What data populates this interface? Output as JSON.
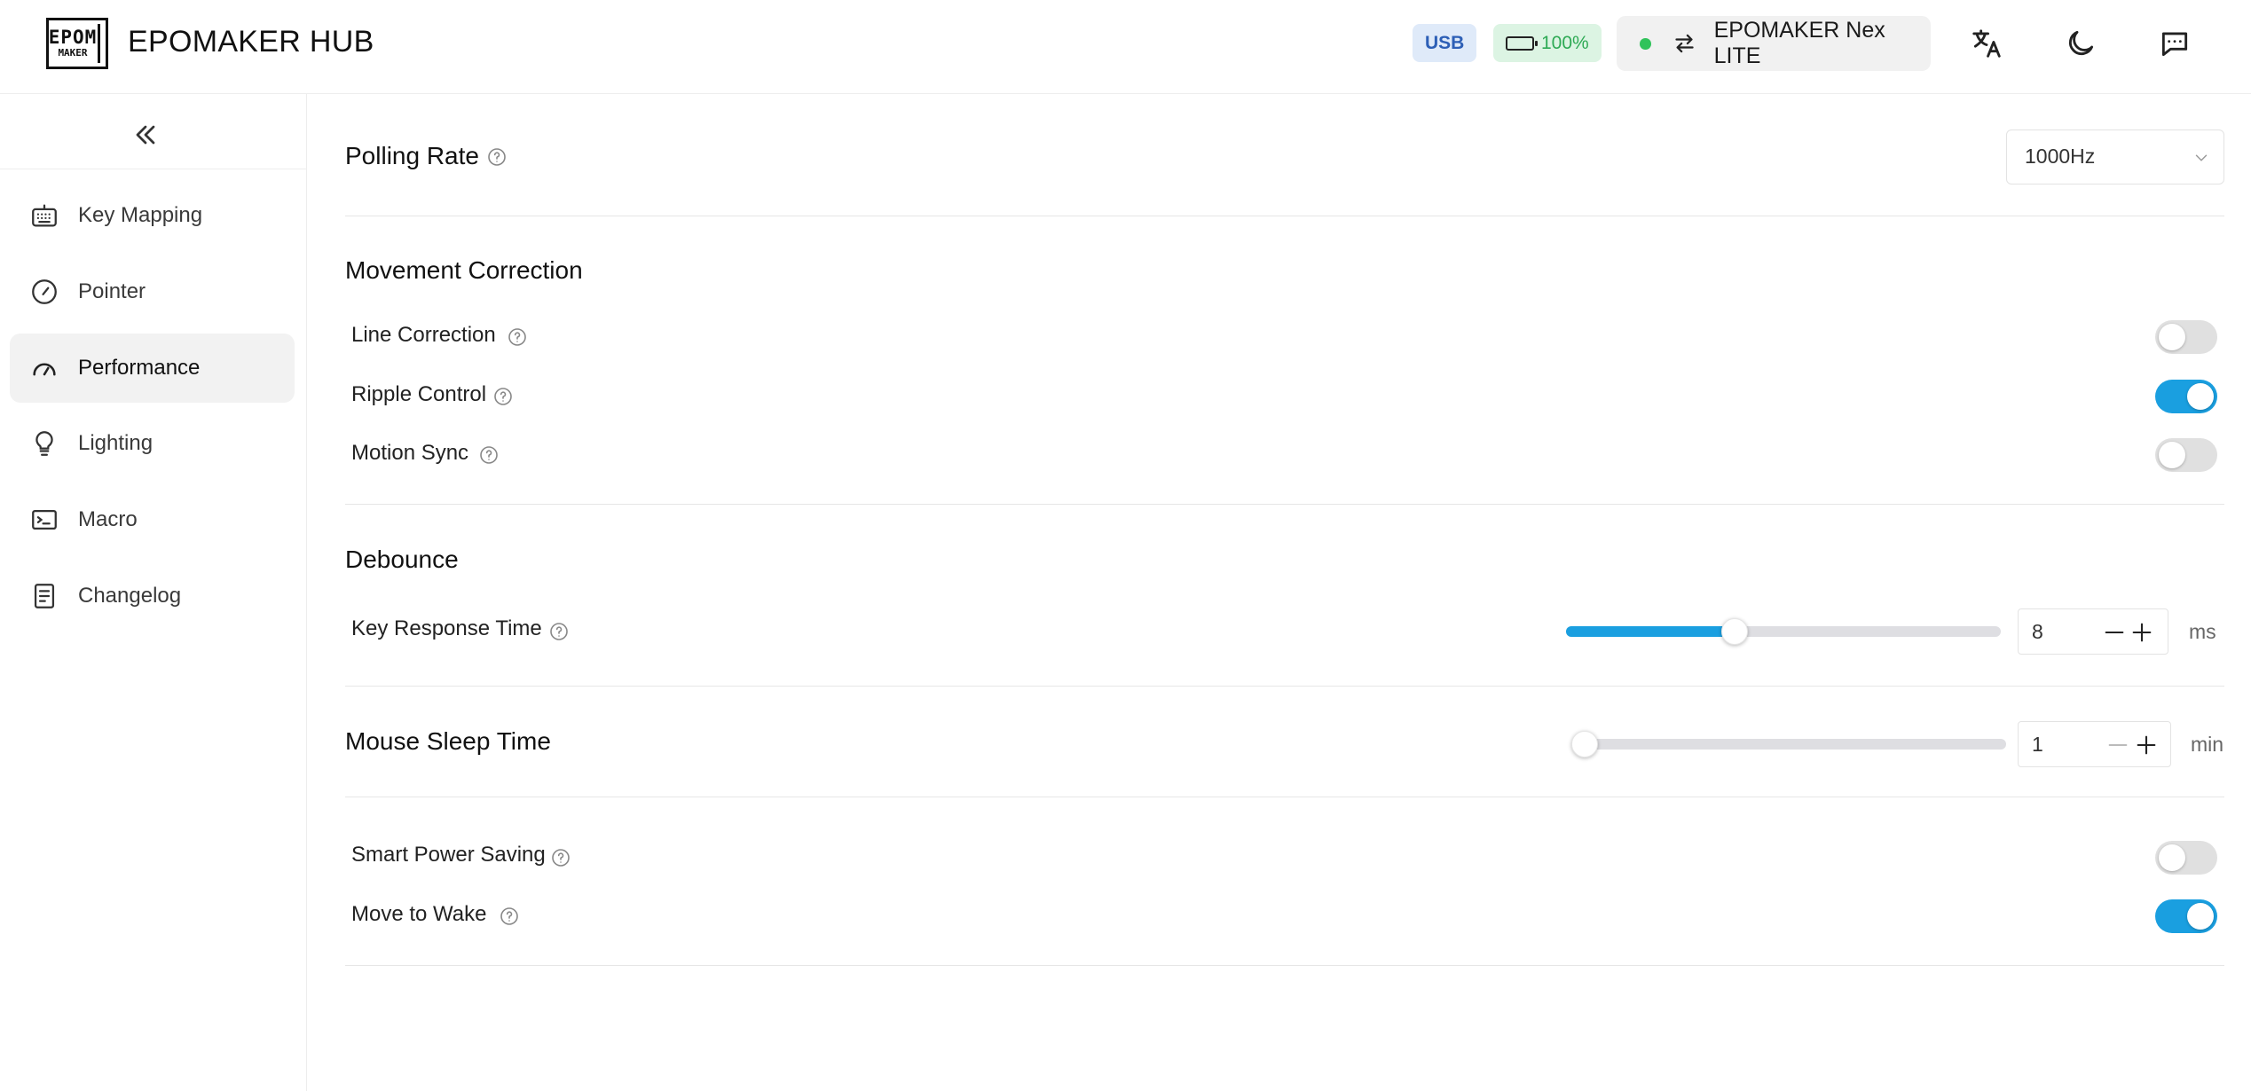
{
  "header": {
    "logo_top": "EPOM",
    "logo_bottom": "MAKER",
    "title": "EPOMAKER HUB",
    "connection": "USB",
    "battery": "100%",
    "device_name": "EPOMAKER Nex LITE",
    "status_color": "#30c35a"
  },
  "sidebar": {
    "items": [
      {
        "label": "Key Mapping",
        "icon": "keyboard-icon"
      },
      {
        "label": "Pointer",
        "icon": "compass-icon"
      },
      {
        "label": "Performance",
        "icon": "gauge-icon",
        "active": true
      },
      {
        "label": "Lighting",
        "icon": "lightbulb-icon"
      },
      {
        "label": "Macro",
        "icon": "terminal-icon"
      },
      {
        "label": "Changelog",
        "icon": "document-icon"
      }
    ]
  },
  "main": {
    "polling_rate": {
      "label": "Polling Rate",
      "value": "1000Hz"
    },
    "movement_correction": {
      "title": "Movement Correction",
      "line_correction": {
        "label": "Line Correction",
        "on": false
      },
      "ripple_control": {
        "label": "Ripple Control",
        "on": true
      },
      "motion_sync": {
        "label": "Motion Sync",
        "on": false
      }
    },
    "debounce": {
      "title": "Debounce",
      "key_response_time": {
        "label": "Key Response Time",
        "value": "8",
        "unit": "ms",
        "slider_fraction": 0.38
      }
    },
    "mouse_sleep_time": {
      "label": "Mouse Sleep Time",
      "value": "1",
      "unit": "min",
      "slider_fraction": 0.0
    },
    "smart_power_saving": {
      "label": "Smart Power Saving",
      "on": false
    },
    "move_to_wake": {
      "label": "Move to Wake",
      "on": true
    },
    "accent_color": "#1a9fe0"
  }
}
